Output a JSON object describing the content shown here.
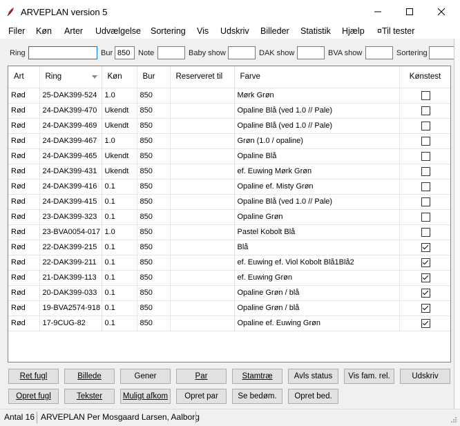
{
  "window": {
    "title": "ARVEPLAN version 5"
  },
  "menu": [
    "Filer",
    "Køn",
    "Arter",
    "Udvælgelse",
    "Sortering",
    "Vis",
    "Udskriv",
    "Billeder",
    "Statistik",
    "Hjælp",
    "¤Til tester"
  ],
  "filters": {
    "ring_label": "Ring",
    "ring_value": "",
    "bur_label": "Bur",
    "bur_value": "850",
    "note_label": "Note",
    "note_value": "",
    "baby_label": "Baby show",
    "baby_value": "",
    "dak_label": "DAK show",
    "dak_value": "",
    "bva_label": "BVA show",
    "bva_value": "",
    "sort_label": "Sortering",
    "sort_value": ""
  },
  "table": {
    "headers": [
      "Art",
      "Ring",
      "Køn",
      "Bur",
      "Reserveret til",
      "Farve",
      "Kønstest"
    ],
    "rows": [
      {
        "art": "Rød",
        "ring": "25-DAK399-524",
        "kon": "1.0",
        "bur": "850",
        "res": "",
        "farve": "Mørk Grøn",
        "test": false
      },
      {
        "art": "Rød",
        "ring": "24-DAK399-470",
        "kon": "Ukendt",
        "bur": "850",
        "res": "",
        "farve": "Opaline Blå (ved 1.0 // Pale)",
        "test": false
      },
      {
        "art": "Rød",
        "ring": "24-DAK399-469",
        "kon": "Ukendt",
        "bur": "850",
        "res": "",
        "farve": "Opaline Blå (ved 1.0 // Pale)",
        "test": false
      },
      {
        "art": "Rød",
        "ring": "24-DAK399-467",
        "kon": "1.0",
        "bur": "850",
        "res": "",
        "farve": "Grøn (1.0 / opaline)",
        "test": false
      },
      {
        "art": "Rød",
        "ring": "24-DAK399-465",
        "kon": "Ukendt",
        "bur": "850",
        "res": "",
        "farve": "Opaline Blå",
        "test": false
      },
      {
        "art": "Rød",
        "ring": "24-DAK399-431",
        "kon": "Ukendt",
        "bur": "850",
        "res": "",
        "farve": "ef. Euwing Mørk Grøn",
        "test": false
      },
      {
        "art": "Rød",
        "ring": "24-DAK399-416",
        "kon": "0.1",
        "bur": "850",
        "res": "",
        "farve": "Opaline ef. Misty Grøn",
        "test": false
      },
      {
        "art": "Rød",
        "ring": "24-DAK399-415",
        "kon": "0.1",
        "bur": "850",
        "res": "",
        "farve": "Opaline Blå (ved 1.0 // Pale)",
        "test": false
      },
      {
        "art": "Rød",
        "ring": "23-DAK399-323",
        "kon": "0.1",
        "bur": "850",
        "res": "",
        "farve": "Opaline Grøn",
        "test": false
      },
      {
        "art": "Rød",
        "ring": "23-BVA0054-017",
        "kon": "1.0",
        "bur": "850",
        "res": "",
        "farve": "Pastel Kobolt Blå",
        "test": false
      },
      {
        "art": "Rød",
        "ring": "22-DAK399-215",
        "kon": "0.1",
        "bur": "850",
        "res": "",
        "farve": "Blå",
        "test": true
      },
      {
        "art": "Rød",
        "ring": "22-DAK399-211",
        "kon": "0.1",
        "bur": "850",
        "res": "",
        "farve": "ef. Euwing ef. Viol Kobolt Blå1Blå2",
        "test": true
      },
      {
        "art": "Rød",
        "ring": "21-DAK399-113",
        "kon": "0.1",
        "bur": "850",
        "res": "",
        "farve": "ef. Euwing Grøn",
        "test": true
      },
      {
        "art": "Rød",
        "ring": "20-DAK399-033",
        "kon": "0.1",
        "bur": "850",
        "res": "",
        "farve": "Opaline Grøn / blå",
        "test": true
      },
      {
        "art": "Rød",
        "ring": "19-BVA2574-918",
        "kon": "0.1",
        "bur": "850",
        "res": "",
        "farve": "Opaline Grøn / blå",
        "test": true
      },
      {
        "art": "Rød",
        "ring": "17-9CUG-82",
        "kon": "0.1",
        "bur": "850",
        "res": "",
        "farve": "Opaline ef. Euwing Grøn",
        "test": true
      }
    ]
  },
  "buttons_row1": [
    "Ret fugl",
    "Billede",
    "Gener",
    "Par",
    "Stamtræ",
    "Avls status",
    "Vis fam. rel.",
    "Udskriv"
  ],
  "buttons_row2": [
    "Opret fugl",
    "Tekster",
    "Muligt afkom",
    "Opret par",
    "Se bedøm.",
    "Opret bed."
  ],
  "status": {
    "count": "Antal 16",
    "owner": "ARVEPLAN Per Mosgaard Larsen, Aalborg"
  }
}
